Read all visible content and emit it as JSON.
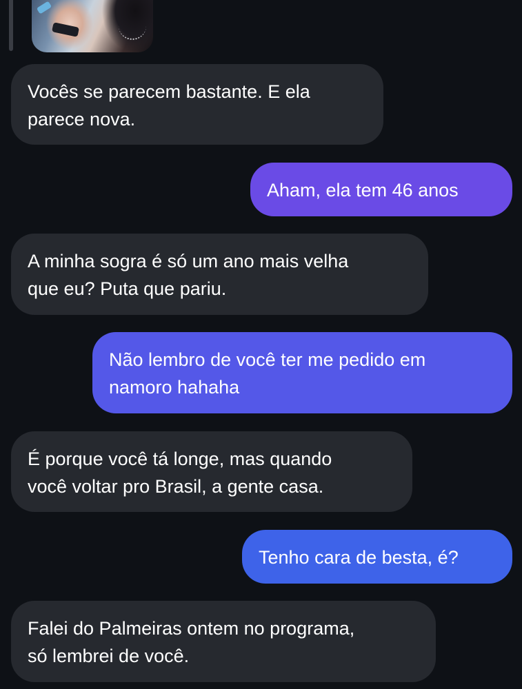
{
  "conversation": {
    "shared_photo": {
      "description_icon": "photo-thumbnail"
    },
    "messages": [
      {
        "direction": "incoming",
        "text": "Vocês se parecem bastante. E ela\nparece nova."
      },
      {
        "direction": "outgoing",
        "text": "Aham, ela tem 46 anos"
      },
      {
        "direction": "incoming",
        "text": "A minha sogra é só um ano mais velha\nque eu? Puta que pariu."
      },
      {
        "direction": "outgoing",
        "text": "Não lembro de você ter me pedido em\nnamoro hahaha"
      },
      {
        "direction": "incoming",
        "text": "É porque você tá longe, mas quando\nvocê voltar pro Brasil, a gente casa."
      },
      {
        "direction": "outgoing",
        "text": "Tenho cara de besta, é?"
      },
      {
        "direction": "incoming",
        "text": "Falei do Palmeiras ontem no programa,\nsó lembrei de você."
      }
    ]
  },
  "colors": {
    "background": "#0e1116",
    "incoming_bubble": "#26292f",
    "outgoing_bubble_top": "#6c4de8",
    "outgoing_bubble_bottom": "#3e63e9",
    "text": "#ffffff"
  }
}
